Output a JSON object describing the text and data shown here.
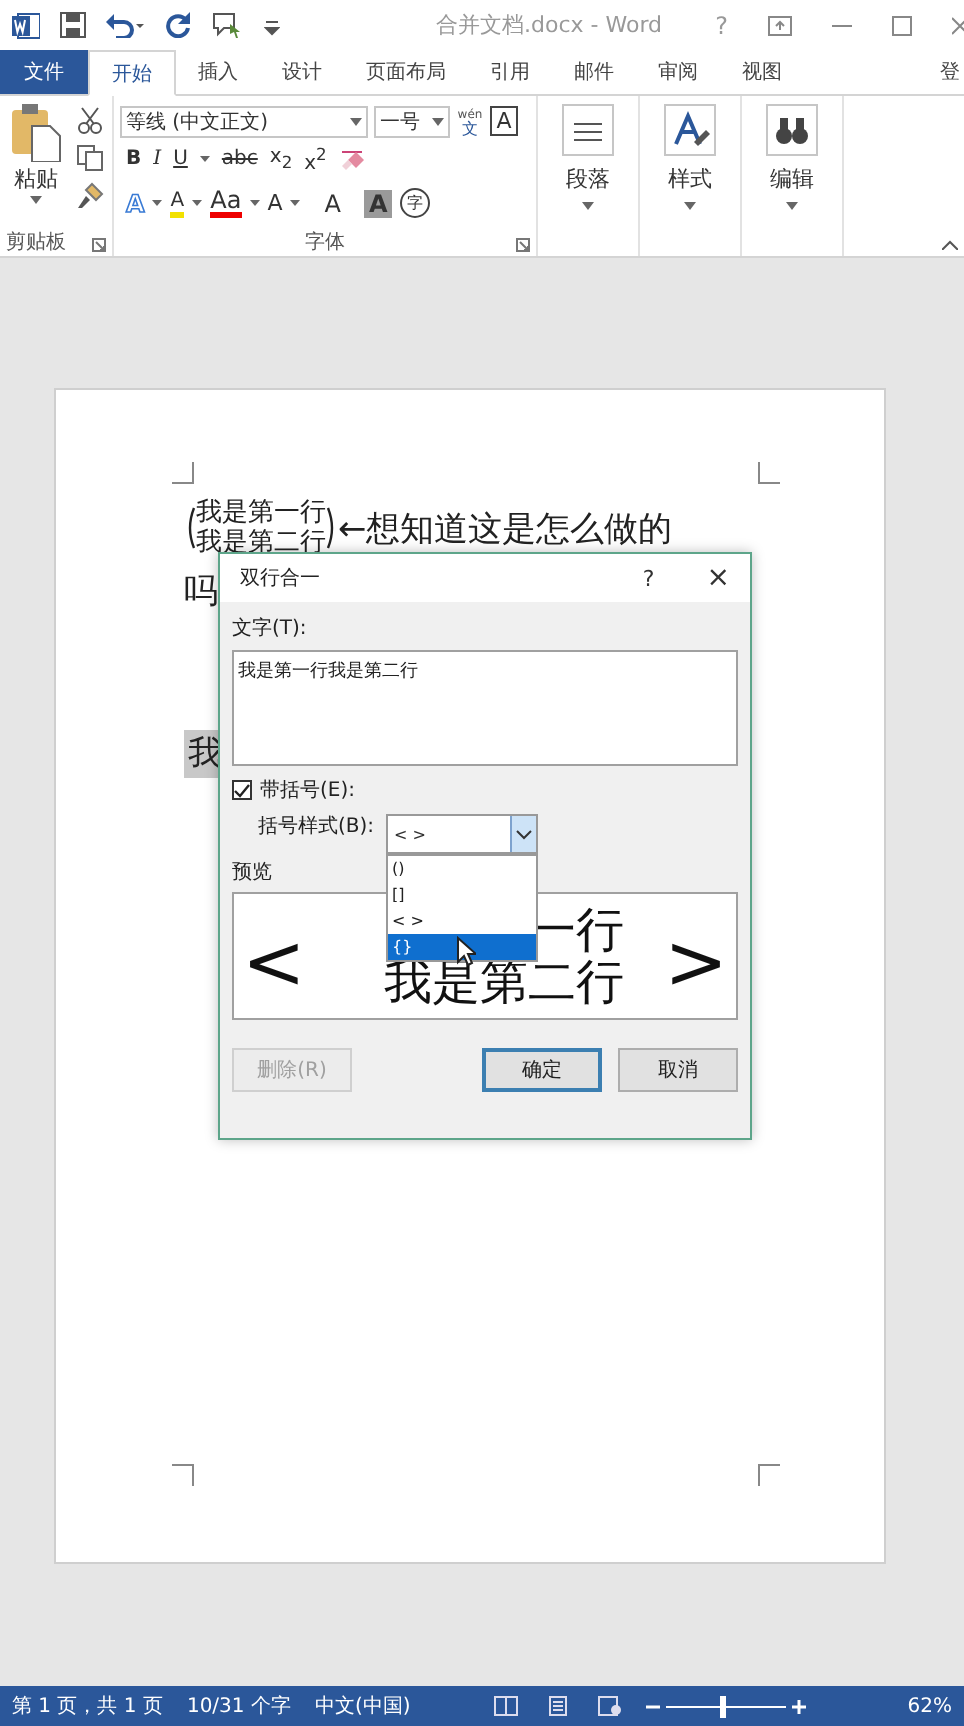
{
  "title_bar": {
    "title": "合并文档.docx - Word",
    "help": "?"
  },
  "tabs": [
    {
      "label": "文件",
      "kind": "file",
      "selected": false
    },
    {
      "label": "开始",
      "kind": "tab",
      "selected": true
    },
    {
      "label": "插入",
      "kind": "tab",
      "selected": false
    },
    {
      "label": "设计",
      "kind": "tab",
      "selected": false
    },
    {
      "label": "页面布局",
      "kind": "tab",
      "selected": false
    },
    {
      "label": "引用",
      "kind": "tab",
      "selected": false
    },
    {
      "label": "邮件",
      "kind": "tab",
      "selected": false
    },
    {
      "label": "审阅",
      "kind": "tab",
      "selected": false
    },
    {
      "label": "视图",
      "kind": "tab",
      "selected": false
    },
    {
      "label": "登",
      "kind": "signin",
      "selected": false
    }
  ],
  "ribbon": {
    "paste_label": "粘贴",
    "clipboard_label": "剪贴板",
    "font_name": "等线 (中文正文)",
    "font_size": "一号",
    "phonetic": "wén",
    "phonetic_char": "文",
    "char_border": "A",
    "format_buttons": [
      "B",
      "I",
      "U",
      "abc",
      "x$_{2}$",
      "x$^{2}$"
    ],
    "effect_buttons": [
      "A",
      "A",
      "Aa",
      "A",
      "A",
      "A",
      "字"
    ],
    "font_label": "字体",
    "groups": [
      {
        "label": "段落"
      },
      {
        "label": "样式"
      },
      {
        "label": "编辑"
      }
    ]
  },
  "document": {
    "bracket_line_1": "我是第一行",
    "bracket_line_2": "我是第二行",
    "arrow_text": "←想知道这是怎么做的",
    "line_2": "吗",
    "selected_text": "我"
  },
  "dialog": {
    "title": "双行合一",
    "help": "?",
    "close": "×",
    "text_label": "文字(T):",
    "text_value": "我是第一行我是第二行",
    "bracket_checkbox": {
      "label": "带括号(E):",
      "checked": true
    },
    "style_label": "括号样式(B):",
    "style_value": "< >",
    "style_options": [
      {
        "label": "()",
        "selected": false
      },
      {
        "label": "[]",
        "selected": false
      },
      {
        "label": "< >",
        "selected": false
      },
      {
        "label": "{}",
        "selected": true
      }
    ],
    "preview_label": "预览",
    "preview_open": "<",
    "preview_close": ">",
    "preview_line_1": "一行",
    "preview_line_2": "我是第二行",
    "buttons": [
      {
        "label": "删除(R)",
        "disabled": true,
        "default": false
      },
      {
        "label": "确定",
        "disabled": false,
        "default": true
      },
      {
        "label": "取消",
        "disabled": false,
        "default": false
      }
    ]
  },
  "status_bar": {
    "page": "第 1 页，共 1 页",
    "words": "10/31 个字",
    "language": "中文(中国)",
    "zoom": {
      "level": 0.45
    },
    "zoom_text": "62%"
  }
}
